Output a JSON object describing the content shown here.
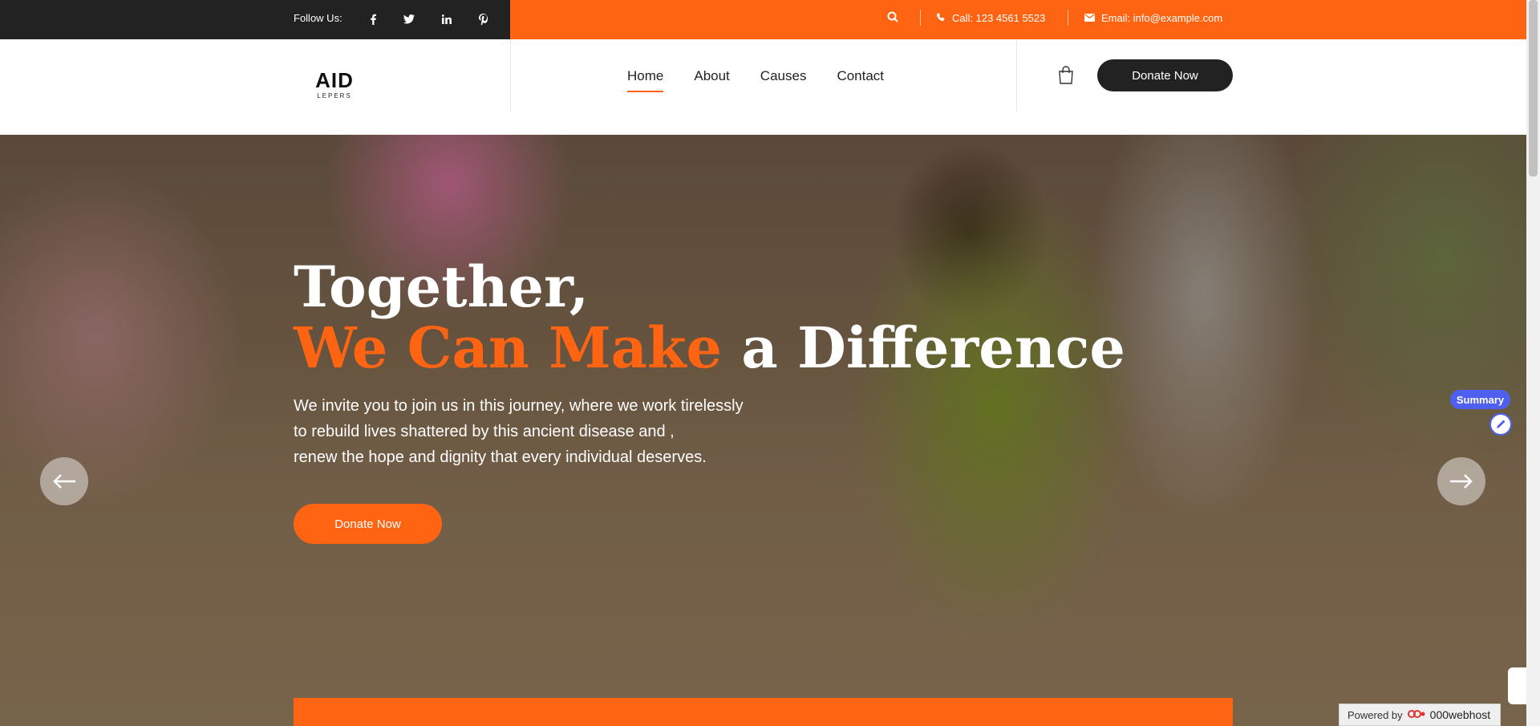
{
  "topbar": {
    "follow_label": "Follow Us:",
    "social_icons": [
      "facebook-icon",
      "twitter-icon",
      "linkedin-icon",
      "pinterest-icon"
    ],
    "phone": "Call: 123 4561 5523",
    "email": "Email: info@example.com",
    "colors": {
      "dark": "#222222",
      "accent": "#ff6412"
    }
  },
  "header": {
    "logo_main": "AID",
    "logo_sub": "LEPERS",
    "nav": [
      {
        "label": "Home",
        "active": true
      },
      {
        "label": "About",
        "active": false
      },
      {
        "label": "Causes",
        "active": false
      },
      {
        "label": "Contact",
        "active": false
      }
    ],
    "donate_label": "Donate Now"
  },
  "hero": {
    "headline_line1": "Together,",
    "headline_accent": "We Can Make",
    "headline_rest": "a Difference",
    "lead_lines": [
      "We invite you to join us in this journey, where we work tirelessly",
      "to rebuild lives shattered by this ancient disease and ,",
      "renew the hope and dignity that every individual deserves."
    ],
    "donate_label": "Donate Now"
  },
  "widgets": {
    "summary_label": "Summary",
    "powered_prefix": "Powered by",
    "powered_brand": "000webhost"
  }
}
